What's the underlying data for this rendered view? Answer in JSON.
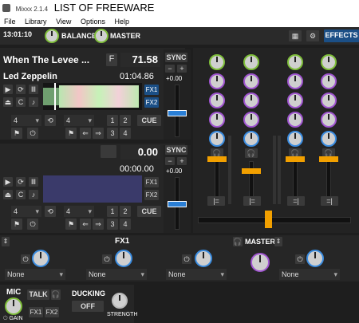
{
  "window": {
    "app": "Mixxx 2.1.4",
    "title": "LIST OF FREEWARE"
  },
  "menu": [
    "File",
    "Library",
    "View",
    "Options",
    "Help"
  ],
  "topbar": {
    "clock": "13:01:10",
    "balance": "BALANCE",
    "master": "MASTER",
    "effects": "EFFECTS"
  },
  "deck1": {
    "title": "When The Levee ...",
    "f": "F",
    "bpm": "71.58",
    "artist": "Led Zeppelin",
    "time": "01:04.86",
    "fx1": "FX1",
    "fx2": "FX2",
    "sync": "SYNC",
    "pitch": "+0.00",
    "loop1": "4",
    "loop2": "4",
    "hot": [
      "1",
      "2",
      "3",
      "4"
    ],
    "cue": "CUE"
  },
  "deck2": {
    "bpm": "0.00",
    "time": "00:00.00",
    "fx1": "FX1",
    "fx2": "FX2",
    "sync": "SYNC",
    "pitch": "+0.00",
    "loop1": "4",
    "loop2": "4",
    "hot": [
      "1",
      "2",
      "3",
      "4"
    ],
    "cue": "CUE"
  },
  "fxbar": {
    "fx1": "FX1",
    "master": "MASTER",
    "slots": [
      "None",
      "None",
      "None",
      "None"
    ]
  },
  "mic": {
    "label": "MIC",
    "talk": "TALK",
    "gain": "GAIN",
    "fx1": "FX1",
    "fx2": "FX2",
    "ducking": "DUCKING",
    "off": "OFF",
    "strength": "STRENGTH"
  },
  "colors": {
    "accent": "#f2a000",
    "blue": "#1b4f86",
    "bg": "#1e1e1e"
  }
}
